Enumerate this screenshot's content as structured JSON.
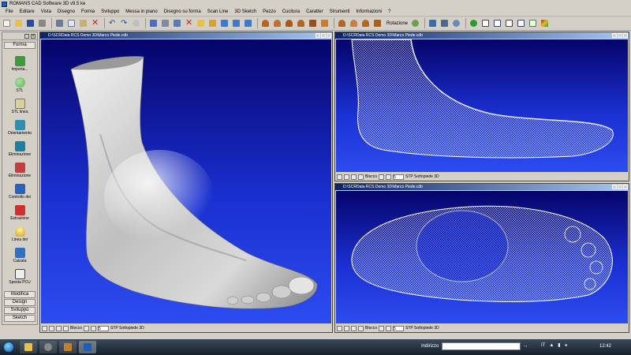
{
  "window": {
    "title": "ROMANS CAD Software 3D v9.5 ke"
  },
  "menu": [
    "File",
    "Editare",
    "Vista",
    "Disegno",
    "Forma",
    "Sviluppo",
    "Messa in piano",
    "Disegno su forma",
    "Scan Line",
    "3D Sketch",
    "Pezzo",
    "Cucitura",
    "Caratter",
    "Strumenti",
    "Informazioni",
    "?"
  ],
  "toolbar": {
    "rotazione_label": "Rotazione",
    "colors": {
      "file": "#e8e4d8",
      "edit": "#4a6fc0",
      "delete": "#d02020",
      "shoe": "#b5651d",
      "box": "#3a6ea8",
      "green": "#2e9a2e"
    }
  },
  "left_panel": {
    "top_tab": "Forma",
    "items": [
      {
        "label": "Importa...",
        "icon": "import-icon",
        "color": "#3c9a3c"
      },
      {
        "label": "STL",
        "icon": "sphere-icon",
        "color": "#5ab05a"
      },
      {
        "label": "STL linea",
        "icon": "curve-icon",
        "color": "#6a8a2a"
      },
      {
        "label": "Orientamento",
        "icon": "orient-icon",
        "color": "#2f8fb0"
      },
      {
        "label": "Eliminazione",
        "icon": "cube-icon",
        "color": "#1f7fa0"
      },
      {
        "label": "Eliminazione",
        "icon": "cut-icon",
        "color": "#c04040"
      },
      {
        "label": "Controllo dei",
        "icon": "check-icon",
        "color": "#2a60c0"
      },
      {
        "label": "Estrazione",
        "icon": "extract-icon",
        "color": "#d03030"
      },
      {
        "label": "Linea dei",
        "icon": "bulb-icon",
        "color": "#d0a020"
      },
      {
        "label": "Calzata",
        "icon": "fit-icon",
        "color": "#3070c0"
      },
      {
        "label": "Sposta PCU",
        "icon": "move-icon",
        "color": "#444444"
      }
    ],
    "bottom_tabs": [
      "Modifica",
      "Design",
      "Sviluppo",
      "Sketch"
    ]
  },
  "views": [
    {
      "title": "D:\\SCRData RCS Demo 3D\\Marco Piede.cdb",
      "status_num": "5",
      "status_text": "STP Sottopiede 3D",
      "blocco": "Blocco"
    },
    {
      "title": "D:\\SCRData RCS Demo 3D\\Marco Piede.cdb",
      "status_num": "5",
      "status_text": "STP Sottopiede 3D",
      "blocco": "Blocco"
    },
    {
      "title": "D:\\SCRData RCS Demo 3D\\Marco Piede.cdb",
      "status_num": "5",
      "status_text": "STP Sottopiede 3D",
      "blocco": "Blocco"
    }
  ],
  "taskbar": {
    "address_label": "Indirizzo",
    "lang": "IT",
    "time": "12:42"
  }
}
